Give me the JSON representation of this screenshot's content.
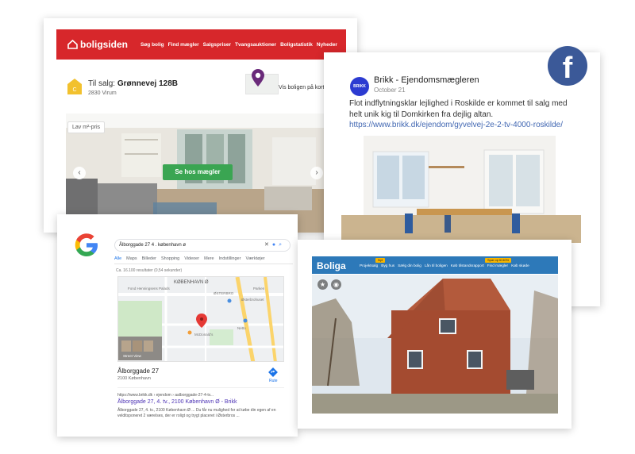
{
  "boligsiden": {
    "logo": "boligsiden",
    "nav": [
      "Søg bolig",
      "Find mægler",
      "Salgspriser",
      "Tvangsauktioner",
      "Boligstatistik",
      "Nyheder"
    ],
    "badge_letter": "C",
    "for_sale_label": "Til salg:",
    "address": "Grønnevej 128B",
    "city": "2830 Virum",
    "map_link": "Vis boligen på kort",
    "price_tag": "Lav m²-pris",
    "cta": "Se hos mægler",
    "brand_color": "#d7272b",
    "cta_color": "#3aa552"
  },
  "facebook": {
    "avatar_text": "BRIKK",
    "page_name": "Brikk - Ejendomsmægleren",
    "date": "October 21",
    "post_text": "Flot indflytningsklar lejlighed i Roskilde er kommet til salg med helt unik kig til Domkirken fra dejlig altan.",
    "link": "https://www.brikk.dk/ejendom/gyvelvej-2e-2-tv-4000-roskilde/",
    "badge_letter": "f",
    "brand_color": "#3b5998"
  },
  "google": {
    "query": "Ålborggade 27 4 . københavn ø",
    "tabs": [
      "Alle",
      "Maps",
      "Billeder",
      "Shopping",
      "Videoer",
      "Mere",
      "Indstillinger",
      "Værktøjer"
    ],
    "result_count": "Ca. 16.100 resultater (0,54 sekunder)",
    "map_labels": [
      "KØBENHAVN Ø",
      "ØSTERBRO",
      "Fond Henningsens Palads",
      "Østerbrohuset",
      "Parken",
      "Street View",
      "McDonald's",
      "Netto"
    ],
    "place_name": "Ålborggade 27",
    "place_address": "2100 København",
    "route_label": "Rute",
    "result_url": "https://www.brikk.dk › ejendom › aalborggade-27-4-tv...",
    "result_title": "Ålborggade 27, 4. tv., 2100 København Ø - Brikk",
    "result_snippet": "Ålborggade 27, 4. tv., 2100 København Ø ... Du får nu mulighed for at købe din egen af en velditsponeret 2 værelses, der er roligt og trygt placeret i Østerbros ..."
  },
  "boliga": {
    "logo": "Boliga",
    "nav": [
      "Projektsalg",
      "Byg hus",
      "Sælg din bolig",
      "Lån til boligen",
      "Køb tilstandsrapport",
      "Find mægler",
      "Køb skøde"
    ],
    "tag_new": "Nyt",
    "tag_offer": "Spar op til 60%",
    "brand_color": "#2d79b9"
  }
}
